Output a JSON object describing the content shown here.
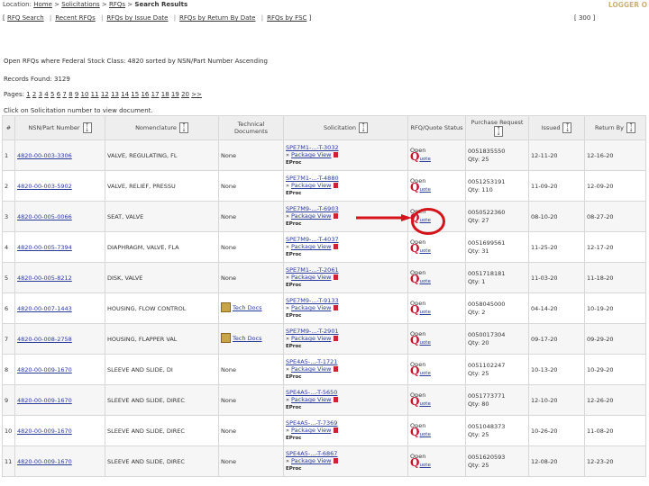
{
  "header": {
    "breadcrumb_prefix": "Location:",
    "crumbs": [
      "Home",
      "Solicitations",
      "RFQs"
    ],
    "current": "Search Results",
    "logout": "LOGGER O"
  },
  "nav": {
    "items": [
      "RFQ Search",
      "Recent RFQs",
      "RFQs by Issue Date",
      "RFQs by Return By Date",
      "RFQs by FSC"
    ],
    "fsc_right": "[ 300 ]"
  },
  "summary": {
    "query": "Open RFQs where Federal Stock Class: 4820 sorted by NSN/Part Number Ascending",
    "records": "Records Found: 3129",
    "pages_prefix": "Pages:",
    "pages": [
      "1",
      "2",
      "3",
      "4",
      "5",
      "6",
      "7",
      "8",
      "9",
      "10",
      "11",
      "12",
      "13",
      "14",
      "15",
      "16",
      "17",
      "18",
      "19",
      "20",
      ">>"
    ],
    "instruction": "Click on Solicitation number to view document."
  },
  "table": {
    "headers": {
      "index": "#",
      "nsn": "NSN/Part Number",
      "nomenclature": "Nomenclature",
      "tech": "Technical Documents",
      "solicitation": "Solicitation",
      "status": "RFQ/Quote Status",
      "pr": "Purchase Request",
      "issued": "Issued",
      "return_by": "Return By"
    },
    "package_view_label": "Package View",
    "ep_label": "EProc",
    "status_open": "Open",
    "quote_label": "uote",
    "rows": [
      {
        "idx": "1",
        "nsn": "4820-00-003-3306",
        "nom": "VALVE, REGULATING, FL",
        "tech": "None",
        "sol": "SPE7M1-...-T-3032",
        "pr": "0051835550",
        "qty": "Qty: 25",
        "issued": "12-11-20",
        "ret": "12-16-20"
      },
      {
        "idx": "2",
        "nsn": "4820-00-003-5902",
        "nom": "VALVE, RELIEF, PRESSU",
        "tech": "None",
        "sol": "SPE7M1-...-T-4880",
        "pr": "0051253191",
        "qty": "Qty: 110",
        "issued": "11-09-20",
        "ret": "12-09-20"
      },
      {
        "idx": "3",
        "nsn": "4820-00-005-0066",
        "nom": "SEAT, VALVE",
        "tech": "None",
        "sol": "SPE7M9-...-T-6903",
        "pr": "0050522360",
        "qty": "Qty: 27",
        "issued": "08-10-20",
        "ret": "08-27-20"
      },
      {
        "idx": "4",
        "nsn": "4820-00-005-7394",
        "nom": "DIAPHRAGM, VALVE, FLA",
        "tech": "None",
        "sol": "SPE7M9-...-T-4037",
        "pr": "0051699561",
        "qty": "Qty: 31",
        "issued": "11-25-20",
        "ret": "12-17-20"
      },
      {
        "idx": "5",
        "nsn": "4820-00-005-8212",
        "nom": "DISK, VALVE",
        "tech": "None",
        "sol": "SPE7M1-...-T-2061",
        "pr": "0051718181",
        "qty": "Qty: 1",
        "issued": "11-03-20",
        "ret": "11-18-20"
      },
      {
        "idx": "6",
        "nsn": "4820-00-007-1443",
        "nom": "HOUSING, FLOW CONTROL",
        "tech": "Tech Docs",
        "sol": "SPE7M9-...-T-9133",
        "pr": "0058045000",
        "qty": "Qty: 2",
        "issued": "04-14-20",
        "ret": "10-19-20"
      },
      {
        "idx": "7",
        "nsn": "4820-00-008-2758",
        "nom": "HOUSING, FLAPPER VAL",
        "tech": "Tech Docs",
        "sol": "SPE7M9-...-T-2901",
        "pr": "0050017304",
        "qty": "Qty: 20",
        "issued": "09-17-20",
        "ret": "09-29-20"
      },
      {
        "idx": "8",
        "nsn": "4820-00-009-1670",
        "nom": "SLEEVE AND SLIDE, DI",
        "tech": "None",
        "sol": "SPE4A5-...-T-1721",
        "pr": "0051102247",
        "qty": "Qty: 25",
        "issued": "10-13-20",
        "ret": "10-29-20"
      },
      {
        "idx": "9",
        "nsn": "4820-00-009-1670",
        "nom": "SLEEVE AND SLIDE, DIREC",
        "tech": "None",
        "sol": "SPE4A5-...-T-5650",
        "pr": "0051773771",
        "qty": "Qty: 80",
        "issued": "12-10-20",
        "ret": "12-26-20"
      },
      {
        "idx": "10",
        "nsn": "4820-00-009-1670",
        "nom": "SLEEVE AND SLIDE, DIREC",
        "tech": "None",
        "sol": "SPE4A5-...-T-7369",
        "pr": "0051048373",
        "qty": "Qty: 25",
        "issued": "10-26-20",
        "ret": "11-08-20"
      },
      {
        "idx": "11",
        "nsn": "4820-00-009-1670",
        "nom": "SLEEVE AND SLIDE, DIREC",
        "tech": "None",
        "sol": "SPE4A5-...-T-6867",
        "pr": "0051620593",
        "qty": "Qty: 25",
        "issued": "12-08-20",
        "ret": "12-23-20"
      }
    ]
  },
  "colors": {
    "annotation": "#d4141a",
    "quote_q": "#c8102e",
    "link": "#2a3a9a"
  },
  "icons": [
    "sort-icon",
    "flag-icon",
    "quote-q-icon",
    "tech-docs-icon",
    "arrow-annotation",
    "circle-annotation"
  ]
}
